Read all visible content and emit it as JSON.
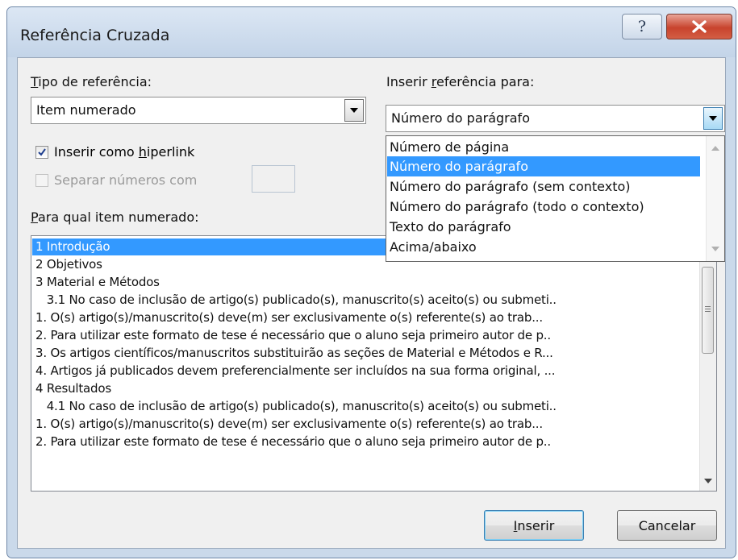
{
  "dialog": {
    "title": "Referência Cruzada"
  },
  "reference_type": {
    "label_accel": "T",
    "label_rest": "ipo de referência:",
    "value": "Item numerado"
  },
  "insert_reference": {
    "label_pre": "Inserir ",
    "label_accel": "r",
    "label_rest": "eferência para:",
    "value": "Número do parágrafo",
    "options": [
      "Número de página",
      "Número do parágrafo",
      "Número do parágrafo (sem contexto)",
      "Número do parágrafo (todo o contexto)",
      "Texto do parágrafo",
      "Acima/abaixo"
    ],
    "selected_index": 1
  },
  "hyperlink_checkbox": {
    "label_pre": "Inserir como ",
    "label_accel": "h",
    "label_rest": "iperlink",
    "checked": true
  },
  "separate_checkbox": {
    "label": "Separar números com",
    "checked": false,
    "disabled": true
  },
  "items_list": {
    "label_accel": "P",
    "label_rest": "ara qual item numerado:",
    "items": [
      "1 Introdução",
      "2 Objetivos",
      "3 Material e Métodos",
      "   3.1 No caso de inclusão de artigo(s) publicado(s), manuscrito(s) aceito(s) ou submeti..",
      "1. O(s) artigo(s)/manuscrito(s) deve(m) ser exclusivamente o(s) referente(s) ao trab...",
      "2. Para utilizar este formato de tese é necessário que o aluno seja primeiro autor de p..",
      "3. Os artigos científicos/manuscritos substituirão as seções de Material e Métodos e R...",
      "4. Artigos já publicados devem preferencialmente ser incluídos na sua forma original, ...",
      "4 Resultados",
      "   4.1 No caso de inclusão de artigo(s) publicado(s), manuscrito(s) aceito(s) ou submeti..",
      "1. O(s) artigo(s)/manuscrito(s) deve(m) ser exclusivamente o(s) referente(s) ao trab...",
      "2. Para utilizar este formato de tese é necessário que o aluno seja primeiro autor de p.."
    ],
    "selected_index": 0
  },
  "buttons": {
    "insert_accel": "I",
    "insert_rest": "nserir",
    "cancel": "Cancelar"
  },
  "colors": {
    "selection": "#3399ff",
    "close_button": "#c8432d",
    "dialog_face": "#f0f0f0"
  },
  "icons": [
    "help-icon",
    "close-icon",
    "chevron-down-icon",
    "checkmark-icon",
    "scroll-up-icon",
    "scroll-down-icon"
  ]
}
